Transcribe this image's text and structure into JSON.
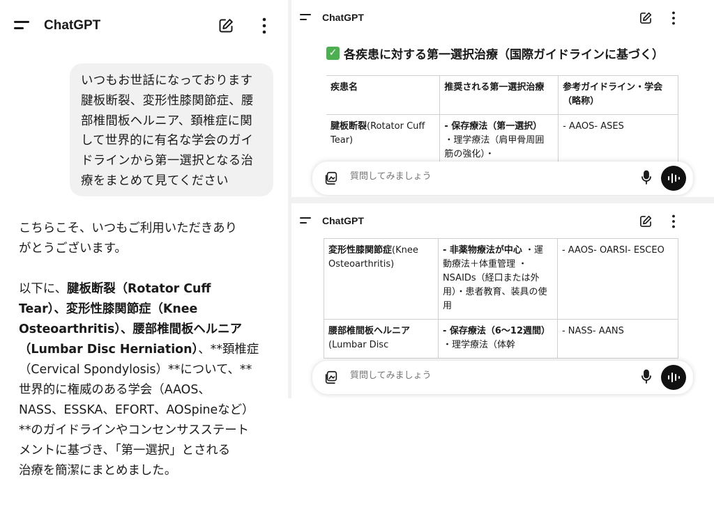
{
  "app": {
    "title": "ChatGPT"
  },
  "chat": {
    "user_message_lines": [
      "いつもお世話になっております",
      "腱板断裂、変形性膝関節症、腰",
      "部椎間板ヘルニア、頚椎症に関",
      "して世界的に有名な学会のガイ",
      "ドラインから第一選択となる治",
      "療をまとめて見てください"
    ],
    "assistant": {
      "p1_lines": [
        "こちらこそ、いつもご利用いただきあり",
        "がとうございます。"
      ],
      "p2": {
        "l1_a": "以下に、",
        "l1_b": "腱板断裂（Rotator Cuff",
        "l2": "Tear）、変形性膝関節症（Knee",
        "l3": "Osteoarthritis）、腰部椎間板ヘルニア",
        "l4_b": "（Lumbar Disc Herniation）",
        "l4_c": "、**頚椎症",
        "l5": "（Cervical Spondylosis）**について、**",
        "l6": "世界的に権威のある学会（AAOS、",
        "l7": "NASS、ESSKA、EFORT、AOSpineなど）",
        "l8": "**のガイドラインやコンセンサスステート",
        "l9": "メントに基づき、「第一選択」とされる",
        "l10": "治療を簡潔にまとめました。"
      }
    }
  },
  "guideline": {
    "heading_icon": "✓",
    "heading": "各疾患に対する第一選択治療（国際ガイドラインに基づく）",
    "headers": [
      "疾患名",
      "推奨される第一選択治療",
      "参考ガイドライン・学会（略称）"
    ],
    "rows_top": [
      {
        "disease": "腱板断裂",
        "disease_en": "(Rotator Cuff Tear)",
        "treat_bold": "- 保存療法（第一選択）",
        "treat_rest": "・理学療法（肩甲骨周囲筋の強化）・",
        "ref": "- AAOS- ASES"
      }
    ],
    "rows_bottom": [
      {
        "disease": "変形性膝関節症",
        "disease_en": "(Knee Osteoarthritis)",
        "treat_bold": "- 非薬物療法が中心",
        "treat_rest": "・運動療法＋体重管理 ・NSAIDs（経口または外用）・患者教育、装具の使用",
        "ref": "- AAOS- OARSI- ESCEO"
      },
      {
        "disease": "腰部椎間板ヘルニア",
        "disease_en": "(Lumbar Disc",
        "treat_bold": "- 保存療法（6〜12週間）",
        "treat_rest": "・理学療法（体幹",
        "ref": "- NASS- AANS"
      }
    ]
  },
  "input": {
    "placeholder": "質問してみましょう"
  },
  "icons": {
    "menu": "menu-icon",
    "edit": "edit-icon",
    "more": "more-vertical-icon",
    "attach": "attach-icon",
    "mic": "mic-icon",
    "voice": "voice-mode-icon"
  },
  "colors": {
    "accent": "#111111",
    "bubble": "#f1f1f1",
    "check": "#4caf50"
  }
}
